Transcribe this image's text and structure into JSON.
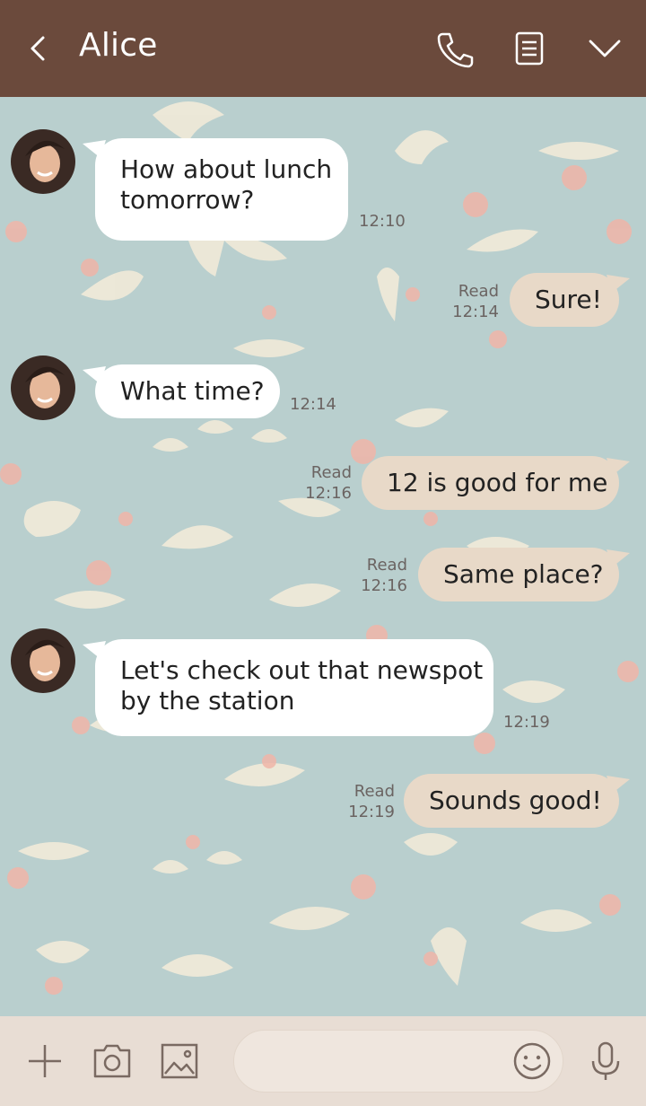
{
  "header": {
    "title": "Alice",
    "back_icon": "chevron-left-icon",
    "call_icon": "phone-icon",
    "notes_icon": "notes-icon",
    "menu_icon": "chevron-down-icon"
  },
  "colors": {
    "header": "#6b4a3c",
    "background": "#b9cfce",
    "incoming_bubble": "#ffffff",
    "outgoing_bubble": "#e8d9c8",
    "input_bar": "#e8ddd4"
  },
  "messages": [
    {
      "side": "in",
      "lines": [
        "How about lunch",
        "tomorrow?"
      ],
      "time": "12:10"
    },
    {
      "side": "out",
      "text": "Sure!",
      "read": "Read",
      "time": "12:14"
    },
    {
      "side": "in",
      "text": "What time?",
      "time": "12:14"
    },
    {
      "side": "out",
      "text": "12 is good for me",
      "read": "Read",
      "time": "12:16"
    },
    {
      "side": "out",
      "text": "Same place?",
      "read": "Read",
      "time": "12:16"
    },
    {
      "side": "in",
      "lines": [
        "Let's check out that newspot",
        "by the station"
      ],
      "time": "12:19"
    },
    {
      "side": "out",
      "text": "Sounds good!",
      "read": "Read",
      "time": "12:19"
    }
  ],
  "input": {
    "placeholder": "",
    "value": "",
    "icons": [
      "plus-icon",
      "camera-icon",
      "image-icon",
      "emoji-icon",
      "microphone-icon"
    ]
  }
}
